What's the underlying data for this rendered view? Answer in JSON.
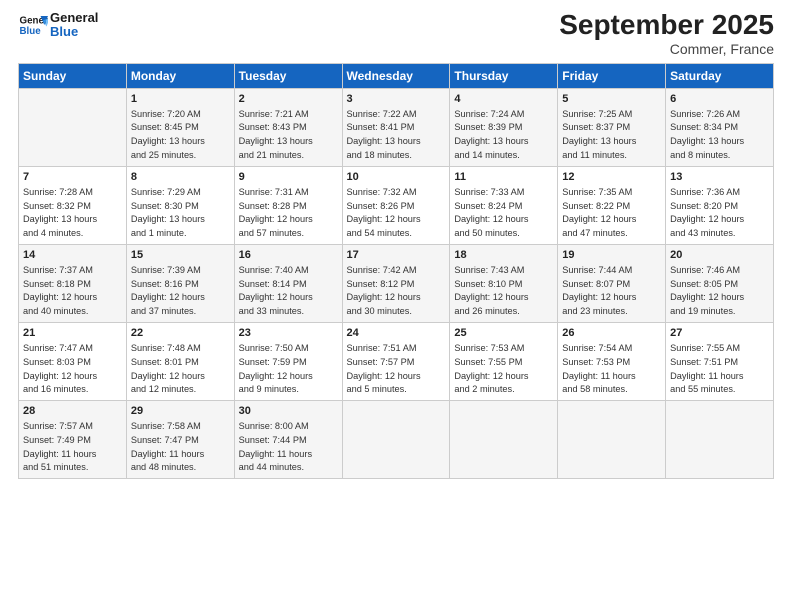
{
  "header": {
    "logo_line1": "General",
    "logo_line2": "Blue",
    "title": "September 2025",
    "subtitle": "Commer, France"
  },
  "days_of_week": [
    "Sunday",
    "Monday",
    "Tuesday",
    "Wednesday",
    "Thursday",
    "Friday",
    "Saturday"
  ],
  "weeks": [
    [
      {
        "day": "",
        "info": ""
      },
      {
        "day": "1",
        "info": "Sunrise: 7:20 AM\nSunset: 8:45 PM\nDaylight: 13 hours\nand 25 minutes."
      },
      {
        "day": "2",
        "info": "Sunrise: 7:21 AM\nSunset: 8:43 PM\nDaylight: 13 hours\nand 21 minutes."
      },
      {
        "day": "3",
        "info": "Sunrise: 7:22 AM\nSunset: 8:41 PM\nDaylight: 13 hours\nand 18 minutes."
      },
      {
        "day": "4",
        "info": "Sunrise: 7:24 AM\nSunset: 8:39 PM\nDaylight: 13 hours\nand 14 minutes."
      },
      {
        "day": "5",
        "info": "Sunrise: 7:25 AM\nSunset: 8:37 PM\nDaylight: 13 hours\nand 11 minutes."
      },
      {
        "day": "6",
        "info": "Sunrise: 7:26 AM\nSunset: 8:34 PM\nDaylight: 13 hours\nand 8 minutes."
      }
    ],
    [
      {
        "day": "7",
        "info": "Sunrise: 7:28 AM\nSunset: 8:32 PM\nDaylight: 13 hours\nand 4 minutes."
      },
      {
        "day": "8",
        "info": "Sunrise: 7:29 AM\nSunset: 8:30 PM\nDaylight: 13 hours\nand 1 minute."
      },
      {
        "day": "9",
        "info": "Sunrise: 7:31 AM\nSunset: 8:28 PM\nDaylight: 12 hours\nand 57 minutes."
      },
      {
        "day": "10",
        "info": "Sunrise: 7:32 AM\nSunset: 8:26 PM\nDaylight: 12 hours\nand 54 minutes."
      },
      {
        "day": "11",
        "info": "Sunrise: 7:33 AM\nSunset: 8:24 PM\nDaylight: 12 hours\nand 50 minutes."
      },
      {
        "day": "12",
        "info": "Sunrise: 7:35 AM\nSunset: 8:22 PM\nDaylight: 12 hours\nand 47 minutes."
      },
      {
        "day": "13",
        "info": "Sunrise: 7:36 AM\nSunset: 8:20 PM\nDaylight: 12 hours\nand 43 minutes."
      }
    ],
    [
      {
        "day": "14",
        "info": "Sunrise: 7:37 AM\nSunset: 8:18 PM\nDaylight: 12 hours\nand 40 minutes."
      },
      {
        "day": "15",
        "info": "Sunrise: 7:39 AM\nSunset: 8:16 PM\nDaylight: 12 hours\nand 37 minutes."
      },
      {
        "day": "16",
        "info": "Sunrise: 7:40 AM\nSunset: 8:14 PM\nDaylight: 12 hours\nand 33 minutes."
      },
      {
        "day": "17",
        "info": "Sunrise: 7:42 AM\nSunset: 8:12 PM\nDaylight: 12 hours\nand 30 minutes."
      },
      {
        "day": "18",
        "info": "Sunrise: 7:43 AM\nSunset: 8:10 PM\nDaylight: 12 hours\nand 26 minutes."
      },
      {
        "day": "19",
        "info": "Sunrise: 7:44 AM\nSunset: 8:07 PM\nDaylight: 12 hours\nand 23 minutes."
      },
      {
        "day": "20",
        "info": "Sunrise: 7:46 AM\nSunset: 8:05 PM\nDaylight: 12 hours\nand 19 minutes."
      }
    ],
    [
      {
        "day": "21",
        "info": "Sunrise: 7:47 AM\nSunset: 8:03 PM\nDaylight: 12 hours\nand 16 minutes."
      },
      {
        "day": "22",
        "info": "Sunrise: 7:48 AM\nSunset: 8:01 PM\nDaylight: 12 hours\nand 12 minutes."
      },
      {
        "day": "23",
        "info": "Sunrise: 7:50 AM\nSunset: 7:59 PM\nDaylight: 12 hours\nand 9 minutes."
      },
      {
        "day": "24",
        "info": "Sunrise: 7:51 AM\nSunset: 7:57 PM\nDaylight: 12 hours\nand 5 minutes."
      },
      {
        "day": "25",
        "info": "Sunrise: 7:53 AM\nSunset: 7:55 PM\nDaylight: 12 hours\nand 2 minutes."
      },
      {
        "day": "26",
        "info": "Sunrise: 7:54 AM\nSunset: 7:53 PM\nDaylight: 11 hours\nand 58 minutes."
      },
      {
        "day": "27",
        "info": "Sunrise: 7:55 AM\nSunset: 7:51 PM\nDaylight: 11 hours\nand 55 minutes."
      }
    ],
    [
      {
        "day": "28",
        "info": "Sunrise: 7:57 AM\nSunset: 7:49 PM\nDaylight: 11 hours\nand 51 minutes."
      },
      {
        "day": "29",
        "info": "Sunrise: 7:58 AM\nSunset: 7:47 PM\nDaylight: 11 hours\nand 48 minutes."
      },
      {
        "day": "30",
        "info": "Sunrise: 8:00 AM\nSunset: 7:44 PM\nDaylight: 11 hours\nand 44 minutes."
      },
      {
        "day": "",
        "info": ""
      },
      {
        "day": "",
        "info": ""
      },
      {
        "day": "",
        "info": ""
      },
      {
        "day": "",
        "info": ""
      }
    ]
  ]
}
